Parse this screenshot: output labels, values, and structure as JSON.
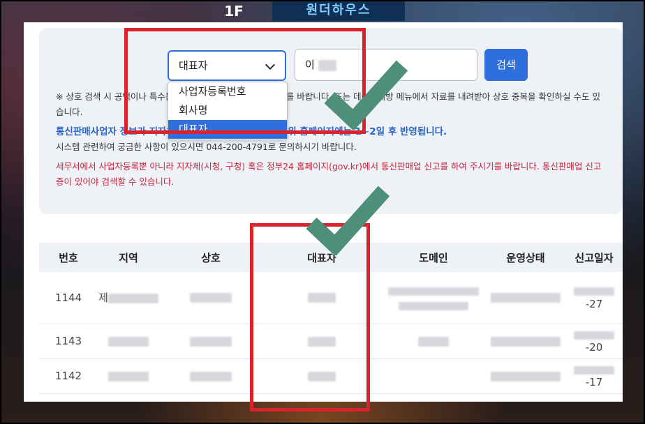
{
  "background": {
    "sign_text": "원더하우스",
    "sign_text_2": "1F"
  },
  "search": {
    "select_value": "대표자",
    "select_options": [
      "사업자등록번호",
      "회사명",
      "대표자"
    ],
    "selected_index": 2,
    "input_value_prefix": "이",
    "button_label": "검색"
  },
  "notes": {
    "note1": "※ 상호 검색 시 공백이나 특수문자를 제외하고 입력하여 주시기를 바랍니다. 또는 데이터개방 메뉴에서 자료를 내려받아 상호 중복을 확인하실 수도 있습니다.",
    "note2_blue": "통신판매사업자 정보가 지자체에 신고·변경·등록하면, 공정위 홈페이지에는 1~2일 후 반영됩니다.",
    "note2": "시스템 관련하여 궁금한 사항이 있으시면 044-200-4791로 문의하시기 바랍니다.",
    "note3_red": "세무서에서 사업자등록뿐 아니라 지자체(시청, 구청) 혹은 정부24 홈페이지(gov.kr)에서 통신판매업 신고를 하여 주시기를 바랍니다. 통신판매업 신고증이 있어야 검색할 수 있습니다."
  },
  "table": {
    "headers": [
      "번호",
      "지역",
      "상호",
      "대표자",
      "도메인",
      "운영상태",
      "신고일자"
    ],
    "rows": [
      {
        "num": "1144",
        "region_prefix": "제",
        "date_suffix": "-27"
      },
      {
        "num": "1143",
        "region_prefix": "",
        "date_suffix": "-20"
      },
      {
        "num": "1142",
        "region_prefix": "",
        "date_suffix": "-17"
      }
    ]
  },
  "colors": {
    "accent": "#2f6fdd",
    "highlight_box": "#d9232e",
    "checkmark": "#4e8f7a"
  }
}
